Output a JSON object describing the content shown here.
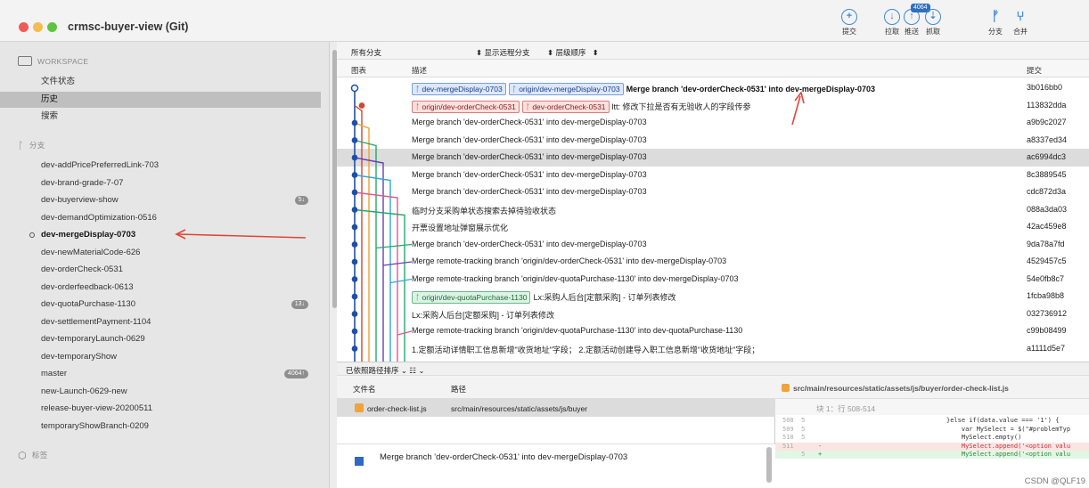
{
  "window": {
    "repo_title": "crmsc-buyer-view (Git)"
  },
  "toolbar": {
    "tools": [
      {
        "label": "提交",
        "icon": "plus-circle-icon",
        "glyph": "+"
      },
      {
        "label": "拉取",
        "icon": "pull-arrow-icon",
        "glyph": "↓"
      },
      {
        "label": "推送",
        "icon": "push-arrow-icon",
        "glyph": "↑",
        "badge": "4064"
      },
      {
        "label": "抓取",
        "icon": "fetch-icon",
        "glyph": "⇣"
      },
      {
        "label": "分支",
        "icon": "branch-icon",
        "glyph": "ᚠ"
      },
      {
        "label": "合并",
        "icon": "merge-icon",
        "glyph": "⑂"
      }
    ]
  },
  "sidebar": {
    "workspace_header": "WORKSPACE",
    "workspace_items": [
      "文件状态",
      "历史",
      "搜索"
    ],
    "branches_header": "分支",
    "branches": [
      {
        "name": "dev-addPricePreferredLink-703"
      },
      {
        "name": "dev-brand-grade-7-07"
      },
      {
        "name": "dev-buyerview-show",
        "badge": "5↓"
      },
      {
        "name": "dev-demandOptimization-0516"
      },
      {
        "name": "dev-mergeDisplay-0703",
        "current": true
      },
      {
        "name": "dev-newMaterialCode-626"
      },
      {
        "name": "dev-orderCheck-0531"
      },
      {
        "name": "dev-orderfeedback-0613"
      },
      {
        "name": "dev-quotaPurchase-1130",
        "badge": "13↓"
      },
      {
        "name": "dev-settlementPayment-1104"
      },
      {
        "name": "dev-temporaryLaunch-0629"
      },
      {
        "name": "dev-temporaryShow"
      },
      {
        "name": "master",
        "badge": "4064↑"
      },
      {
        "name": "new-Launch-0629-new"
      },
      {
        "name": "release-buyer-view-20200511"
      },
      {
        "name": "temporaryShowBranch-0209"
      }
    ],
    "tags_header": "标签"
  },
  "filterbar": {
    "all_branches": "所有分支",
    "show_remote": "显示远程分支",
    "order": "层级顺序"
  },
  "columns": {
    "graph": "图表",
    "description": "描述",
    "commit": "提交"
  },
  "commits": [
    {
      "tags": [
        {
          "text": "dev-mergeDisplay-0703",
          "color": "blue"
        },
        {
          "text": "origin/dev-mergeDisplay-0703",
          "color": "blue"
        }
      ],
      "message": "Merge branch 'dev-orderCheck-0531' into dev-mergeDisplay-0703",
      "bold": true,
      "hash": "3b016bb0"
    },
    {
      "tags": [
        {
          "text": "origin/dev-orderCheck-0531",
          "color": "red"
        },
        {
          "text": "dev-orderCheck-0531",
          "color": "red"
        }
      ],
      "message": "ltt: 修改下拉是否有无验收人的字段传参",
      "hash": "113832dda"
    },
    {
      "tags": [],
      "message": "Merge branch 'dev-orderCheck-0531' into dev-mergeDisplay-0703",
      "hash": "a9b9c2027"
    },
    {
      "tags": [],
      "message": "Merge branch 'dev-orderCheck-0531' into dev-mergeDisplay-0703",
      "hash": "a8337ed34"
    },
    {
      "tags": [],
      "message": "Merge branch 'dev-orderCheck-0531' into dev-mergeDisplay-0703",
      "hash": "ac6994dc3",
      "selected": true
    },
    {
      "tags": [],
      "message": "Merge branch 'dev-orderCheck-0531' into dev-mergeDisplay-0703",
      "hash": "8c3889545"
    },
    {
      "tags": [],
      "message": "Merge branch 'dev-orderCheck-0531' into dev-mergeDisplay-0703",
      "hash": "cdc872d3a"
    },
    {
      "tags": [],
      "message": "临时分支采购单状态搜索去掉待验收状态",
      "hash": "088a3da03"
    },
    {
      "tags": [],
      "message": "开票设置地址弹窗展示优化",
      "hash": "42ac459e8"
    },
    {
      "tags": [],
      "message": "Merge branch 'dev-orderCheck-0531' into dev-mergeDisplay-0703",
      "hash": "9da78a7fd"
    },
    {
      "tags": [],
      "message": "Merge remote-tracking branch 'origin/dev-orderCheck-0531' into dev-mergeDisplay-0703",
      "hash": "4529457c5"
    },
    {
      "tags": [],
      "message": "Merge remote-tracking branch 'origin/dev-quotaPurchase-1130' into dev-mergeDisplay-0703",
      "hash": "54e0fb8c7"
    },
    {
      "tags": [
        {
          "text": "origin/dev-quotaPurchase-1130",
          "color": "green"
        }
      ],
      "message": "Lx:采购人后台[定额采购] - 订单列表修改",
      "hash": "1fcba98b8"
    },
    {
      "tags": [],
      "message": "Lx:采购人后台[定额采购] - 订单列表修改",
      "hash": "032736912"
    },
    {
      "tags": [],
      "message": "Merge remote-tracking branch 'origin/dev-quotaPurchase-1130' into dev-quotaPurchase-1130",
      "hash": "c99b08499"
    },
    {
      "tags": [],
      "message": "1.定额活动详情职工信息新增\"收货地址\"字段； 2.定额活动创建导入职工信息新增\"收货地址\"字段；",
      "hash": "a1111d5e7"
    }
  ],
  "sortbar": {
    "label": "已依照路径排序 ⌄  ☷ ⌄"
  },
  "files": {
    "header_name": "文件名",
    "header_path": "路径",
    "rows": [
      {
        "name": "order-check-list.js",
        "path": "src/main/resources/static/assets/js/buyer"
      }
    ]
  },
  "commit_detail": {
    "message": "Merge branch 'dev-orderCheck-0531' into dev-mergeDisplay-0703"
  },
  "diff": {
    "file_path": "src/main/resources/static/assets/js/buyer/order-check-list.js",
    "hunk": "块 1：行 508-514",
    "lines": [
      {
        "num": "508  5",
        "sign": "",
        "code": "}else if(data.value === '1') {",
        "type": "ctx"
      },
      {
        "num": "509  5",
        "sign": "",
        "code": "    var MySelect = $(\"#problemTyp",
        "type": "ctx"
      },
      {
        "num": "510  5",
        "sign": "",
        "code": "    MySelect.empty()",
        "type": "ctx"
      },
      {
        "num": "511",
        "sign": "-",
        "code": "    MySelect.append('<option valu",
        "type": "del"
      },
      {
        "num": "     5",
        "sign": "+",
        "code": "    MySelect.append('<option valu",
        "type": "add"
      }
    ]
  },
  "watermark": "CSDN @QLF19",
  "colors": {
    "graph_lanes": [
      "#1f4fa8",
      "#d0472f",
      "#f0a030",
      "#22a86a",
      "#6a3fb5",
      "#2fa7d8",
      "#e05a8a"
    ]
  }
}
